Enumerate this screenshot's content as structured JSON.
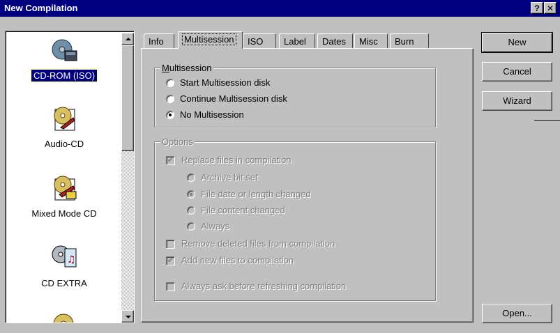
{
  "window": {
    "title": "New Compilation",
    "help_button": "?",
    "close_button": "✕"
  },
  "compilation_types": [
    {
      "label": "CD-ROM (ISO)",
      "icon": "cd-rom-iso-icon",
      "selected": true
    },
    {
      "label": "Audio-CD",
      "icon": "audio-cd-icon",
      "selected": false
    },
    {
      "label": "Mixed Mode CD",
      "icon": "mixed-mode-cd-icon",
      "selected": false
    },
    {
      "label": "CD EXTRA",
      "icon": "cd-extra-icon",
      "selected": false
    }
  ],
  "tabs": [
    {
      "label": "Info"
    },
    {
      "label": "Multisession",
      "active": true
    },
    {
      "label": "ISO"
    },
    {
      "label": "Label"
    },
    {
      "label": "Dates"
    },
    {
      "label": "Misc"
    },
    {
      "label": "Burn"
    }
  ],
  "multisession": {
    "group_title": "Multisession",
    "options": [
      {
        "label": "Start Multisession disk",
        "checked": false
      },
      {
        "label": "Continue Multisession disk",
        "checked": false
      },
      {
        "label": "No Multisession",
        "checked": true
      }
    ]
  },
  "options": {
    "group_title": "Options",
    "replace_files": {
      "label": "Replace files in compilation",
      "checked": true
    },
    "replace_modes": [
      {
        "label": "Archive bit set",
        "checked": false
      },
      {
        "label": "File date or length changed",
        "checked": true
      },
      {
        "label": "File content changed",
        "checked": false
      },
      {
        "label": "Always",
        "checked": false
      }
    ],
    "remove_deleted": {
      "label": "Remove deleted files from compilation",
      "checked": false
    },
    "add_new": {
      "label": "Add new files to compilation",
      "checked": true
    },
    "always_ask": {
      "label": "Always ask before refreshing compilation",
      "checked": false
    }
  },
  "buttons": {
    "new": "New",
    "cancel": "Cancel",
    "wizard": "Wizard",
    "open": "Open..."
  },
  "colors": {
    "titlebar": "#000080",
    "face": "#c0c0c0",
    "selection": "#000080"
  }
}
